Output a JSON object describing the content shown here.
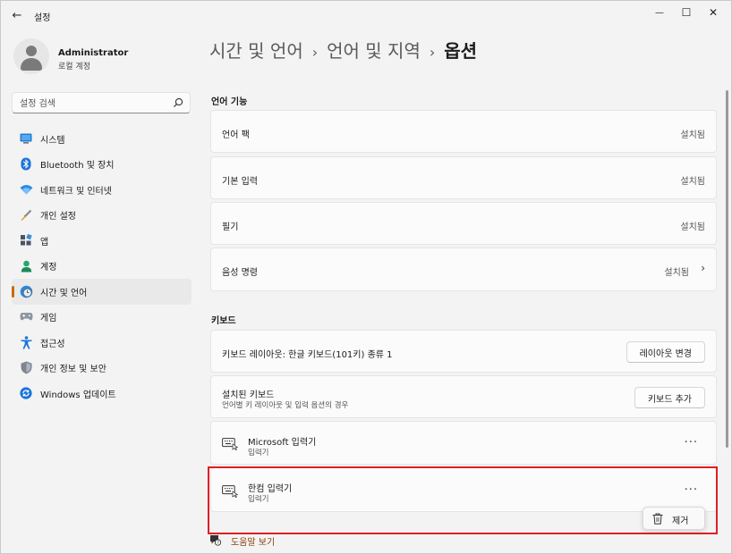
{
  "window": {
    "title": "설정",
    "back_glyph": "←",
    "minimize_glyph": "—",
    "maximize_glyph": "☐",
    "close_glyph": "✕"
  },
  "user": {
    "name": "Administrator",
    "account_type": "로컬 계정"
  },
  "search": {
    "placeholder": "설정 검색"
  },
  "sidebar": {
    "items": [
      {
        "label": "시스템",
        "icon": "monitor-icon"
      },
      {
        "label": "Bluetooth 및 장치",
        "icon": "bluetooth-icon"
      },
      {
        "label": "네트워크 및 인터넷",
        "icon": "wifi-icon"
      },
      {
        "label": "개인 설정",
        "icon": "paintbrush-icon"
      },
      {
        "label": "앱",
        "icon": "apps-icon"
      },
      {
        "label": "계정",
        "icon": "person-icon"
      },
      {
        "label": "시간 및 언어",
        "icon": "globe-clock-icon",
        "active": true
      },
      {
        "label": "게임",
        "icon": "gamepad-icon"
      },
      {
        "label": "접근성",
        "icon": "accessibility-icon"
      },
      {
        "label": "개인 정보 및 보안",
        "icon": "shield-icon"
      },
      {
        "label": "Windows 업데이트",
        "icon": "update-icon"
      }
    ]
  },
  "breadcrumb": {
    "part1": "시간 및 언어",
    "part2": "언어 및 지역",
    "current": "옵션",
    "separator": "›"
  },
  "language_features": {
    "title": "언어 기능",
    "rows": [
      {
        "label": "언어 팩",
        "status": "설치됨"
      },
      {
        "label": "기본 입력",
        "status": "설치됨"
      },
      {
        "label": "필기",
        "status": "설치됨"
      },
      {
        "label": "음성 명령",
        "status": "설치됨",
        "chevron": "›"
      }
    ]
  },
  "keyboard": {
    "title": "키보드",
    "layout_label": "키보드 레이아웃: 한글 키보드(101키) 종류 1",
    "layout_button": "레이아웃 변경",
    "installed_title": "설치된 키보드",
    "installed_sub": "언어별 키 레이아웃 및 입력 옵션의 경우",
    "add_button": "키보드 추가",
    "items": [
      {
        "name": "Microsoft 입력기",
        "type": "입력기",
        "more": "···"
      },
      {
        "name": "한컴 입력기",
        "type": "입력기",
        "more": "···"
      }
    ]
  },
  "context_menu": {
    "remove_label": "제거"
  },
  "help": {
    "link": "도움말 보기"
  },
  "colors": {
    "accent": "#c86a14",
    "highlight_border": "#e01e25",
    "link": "#8b3f0c"
  }
}
